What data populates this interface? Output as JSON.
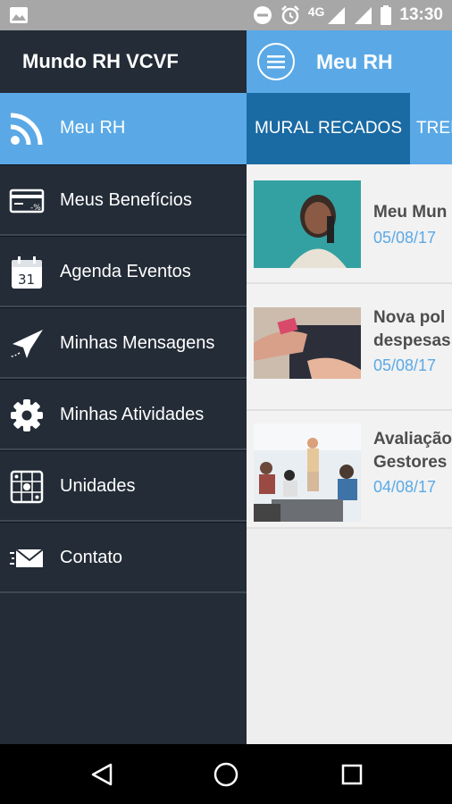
{
  "status_bar": {
    "network": "4G",
    "time": "13:30",
    "icons": [
      "image-icon",
      "do-not-disturb-icon",
      "alarm-icon",
      "signal-icon",
      "signal-icon",
      "battery-icon"
    ]
  },
  "app_bar": {
    "title": "Meu RH",
    "menu_icon": "hamburger-icon"
  },
  "tabs": [
    {
      "label": "MURAL RECADOS",
      "selected": true
    },
    {
      "label": "TREI",
      "selected": false
    }
  ],
  "feed": [
    {
      "title": "Meu Mun",
      "date": "05/08/17",
      "thumb": "woman-phone-photo"
    },
    {
      "title_lines": [
        "Nova pol",
        "despesas"
      ],
      "date": "05/08/17",
      "thumb": "wallet-money-photo"
    },
    {
      "title_lines": [
        "Avaliação",
        "Gestores"
      ],
      "date": "04/08/17",
      "thumb": "meeting-photo"
    }
  ],
  "drawer": {
    "title": "Mundo RH VCVF",
    "items": [
      {
        "label": "Meu RH",
        "icon": "rss-icon",
        "active": true
      },
      {
        "label": "Meus Benefícios",
        "icon": "card-icon",
        "active": false
      },
      {
        "label": "Agenda Eventos",
        "icon": "calendar-icon",
        "active": false,
        "icon_text": "31"
      },
      {
        "label": "Minhas Mensagens",
        "icon": "paper-plane-icon",
        "active": false
      },
      {
        "label": "Minhas Atividades",
        "icon": "gear-icon",
        "active": false
      },
      {
        "label": "Unidades",
        "icon": "unit-grid-icon",
        "active": false
      },
      {
        "label": "Contato",
        "icon": "envelope-icon",
        "active": false
      }
    ]
  },
  "nav_bar": {
    "buttons": [
      "back-icon",
      "home-icon",
      "recents-icon"
    ]
  },
  "colors": {
    "accent": "#5aa9e6",
    "tab_active": "#1a6aa3",
    "drawer_bg": "#232c37",
    "status_bar": "#a7a7a7"
  }
}
